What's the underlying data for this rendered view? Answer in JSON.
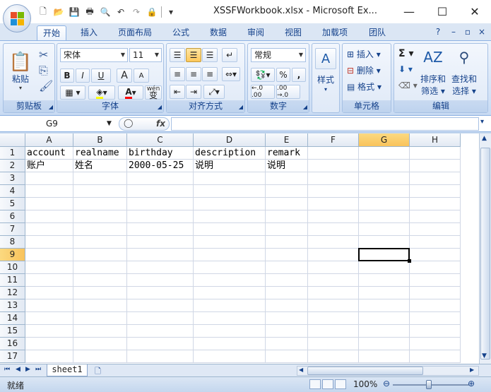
{
  "window": {
    "title": "XSSFWorkbook.xlsx - Microsoft Ex...",
    "minimize_icon": "—",
    "maximize_icon": "☐",
    "close_icon": "✕"
  },
  "qat": {
    "new_icon": "🗋",
    "open_icon": "📂",
    "save_icon": "💾",
    "print_icon": "🖶",
    "preview_icon": "🔍",
    "undo_icon": "↶",
    "redo_icon": "↷",
    "extra_icon": "▾"
  },
  "tabs": [
    "开始",
    "插入",
    "页面布局",
    "公式",
    "数据",
    "审阅",
    "视图",
    "加载项",
    "团队"
  ],
  "ribbon": {
    "clipboard": {
      "paste_label": "粘贴",
      "group_label": "剪贴板"
    },
    "font": {
      "font_name": "宋体",
      "font_size": "11",
      "bold": "B",
      "italic": "I",
      "underline": "U",
      "grow": "A",
      "shrink": "A",
      "wen": "wén",
      "wen_char": "变",
      "group_label": "字体"
    },
    "alignment": {
      "group_label": "对齐方式"
    },
    "number": {
      "format": "常规",
      "percent": "%",
      "comma": ",",
      "group_label": "数字"
    },
    "styles": {
      "label": "样式"
    },
    "cells": {
      "insert": "插入",
      "delete": "删除",
      "format": "格式",
      "group_label": "单元格"
    },
    "editing": {
      "sigma": "Σ",
      "sort_label_1": "排序和",
      "sort_label_2": "筛选",
      "find_label_1": "查找和",
      "find_label_2": "选择",
      "group_label": "编辑"
    }
  },
  "formula_bar": {
    "name_box": "G9",
    "fx": "fx",
    "value": ""
  },
  "columns": [
    "A",
    "B",
    "C",
    "D",
    "E",
    "F",
    "G",
    "H"
  ],
  "rows": [
    "1",
    "2",
    "3",
    "4",
    "5",
    "6",
    "7",
    "8",
    "9",
    "10",
    "11",
    "12",
    "13",
    "14",
    "15",
    "16",
    "17"
  ],
  "cells": {
    "A1": "account",
    "B1": "realname",
    "C1": "birthday",
    "D1": "description",
    "E1": "remark",
    "A2": "账户",
    "B2": "姓名",
    "C2": "2000-05-25",
    "D2": "说明",
    "E2": "说明"
  },
  "selected_cell": "G9",
  "sheets": [
    "sheet1"
  ],
  "status": {
    "ready": "就绪",
    "zoom": "100%"
  },
  "colors": {
    "accent": "#15428b",
    "selected_header": "#f9c35b",
    "ribbon_bg": "#dfe9f7"
  }
}
